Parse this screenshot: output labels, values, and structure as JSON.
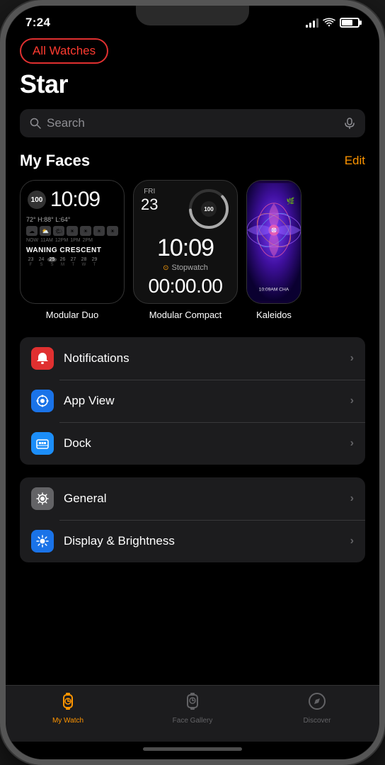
{
  "statusBar": {
    "time": "7:24",
    "locationIcon": "✈",
    "batteryLevel": 70
  },
  "header": {
    "allWatchesLabel": "All Watches",
    "pageTitle": "Star"
  },
  "search": {
    "placeholder": "Search"
  },
  "myFaces": {
    "sectionTitle": "My Faces",
    "editLabel": "Edit",
    "faces": [
      {
        "id": "modular-duo",
        "label": "Modular Duo",
        "time": "10:09",
        "badge": "100",
        "temp": "72° H:88° L:64°",
        "moonPhase": "WANING CRESCENT"
      },
      {
        "id": "modular-compact",
        "label": "Modular Compact",
        "dayName": "FRI",
        "dayNum": "23",
        "time": "10:09",
        "badge": "100",
        "stopwatchLabel": "Stopwatch",
        "stopwatchTime": "00:00.00"
      },
      {
        "id": "kaleidoscope",
        "label": "Kaleidos",
        "time": "10:09AM CHA"
      }
    ]
  },
  "settingsGroups": [
    {
      "id": "group1",
      "items": [
        {
          "id": "notifications",
          "label": "Notifications",
          "iconColor": "red",
          "iconSymbol": "🔔"
        },
        {
          "id": "appview",
          "label": "App View",
          "iconColor": "blue",
          "iconSymbol": "⬡"
        },
        {
          "id": "dock",
          "label": "Dock",
          "iconColor": "blue-light",
          "iconSymbol": "▣"
        }
      ]
    },
    {
      "id": "group2",
      "items": [
        {
          "id": "general",
          "label": "General",
          "iconColor": "gray",
          "iconSymbol": "⚙"
        },
        {
          "id": "displaybrightness",
          "label": "Display & Brightness",
          "iconColor": "orange-blue",
          "iconSymbol": "☀"
        }
      ]
    }
  ],
  "tabBar": {
    "tabs": [
      {
        "id": "mywatch",
        "label": "My Watch",
        "icon": "⌚",
        "active": true
      },
      {
        "id": "facegallery",
        "label": "Face Gallery",
        "icon": "🕐",
        "active": false
      },
      {
        "id": "discover",
        "label": "Discover",
        "icon": "🧭",
        "active": false
      }
    ]
  }
}
